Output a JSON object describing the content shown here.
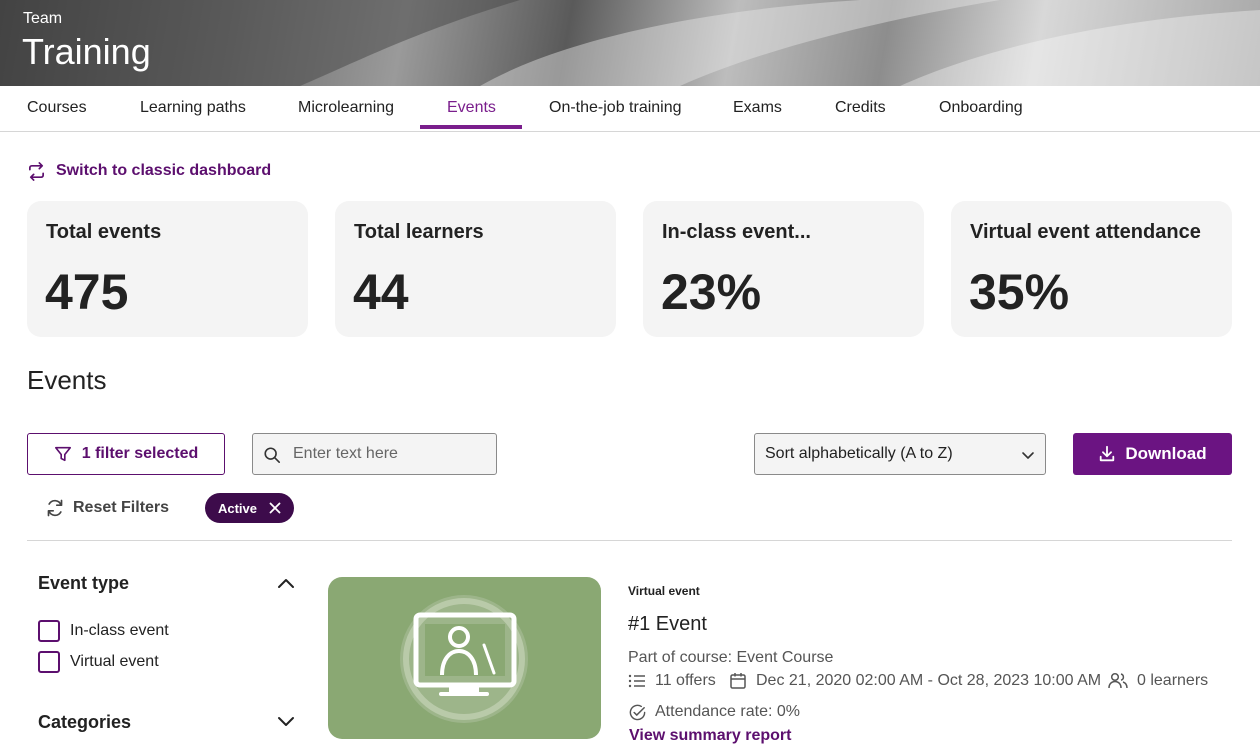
{
  "header": {
    "eyebrow": "Team",
    "title": "Training"
  },
  "tabs": [
    {
      "label": "Courses"
    },
    {
      "label": "Learning paths"
    },
    {
      "label": "Microlearning"
    },
    {
      "label": "Events",
      "active": true
    },
    {
      "label": "On-the-job training"
    },
    {
      "label": "Exams"
    },
    {
      "label": "Credits"
    },
    {
      "label": "Onboarding"
    }
  ],
  "switch_link": {
    "label": "Switch to classic dashboard",
    "icon": "switch-arrows-icon"
  },
  "stats": [
    {
      "label": "Total events",
      "value": "475"
    },
    {
      "label": "Total learners",
      "value": "44"
    },
    {
      "label": "In-class event...",
      "value": "23%"
    },
    {
      "label": "Virtual event attendance",
      "value": "35%"
    }
  ],
  "section": {
    "title": "Events"
  },
  "toolbar": {
    "filter_label": "1 filter selected",
    "search_placeholder": "Enter text here",
    "sort_value": "Sort alphabetically (A to Z)",
    "download_label": "Download",
    "reset_label": "Reset Filters",
    "chip_label": "Active"
  },
  "filters": {
    "event_type": {
      "title": "Event type",
      "options": [
        "In-class event",
        "Virtual event"
      ]
    },
    "categories": {
      "title": "Categories"
    }
  },
  "event": {
    "type": "Virtual event",
    "title": "#1 Event",
    "course": "Part of course: Event Course",
    "offers": "11 offers",
    "dates": "Dec 21, 2020 02:00 AM - Oct 28, 2023 10:00 AM",
    "learners": "0 learners",
    "attendance": "Attendance rate: 0%",
    "summary_link": "View summary report"
  },
  "colors": {
    "accent": "#6b1482",
    "accent_dark": "#3d0b4b",
    "thumb_green": "#8aa873"
  }
}
